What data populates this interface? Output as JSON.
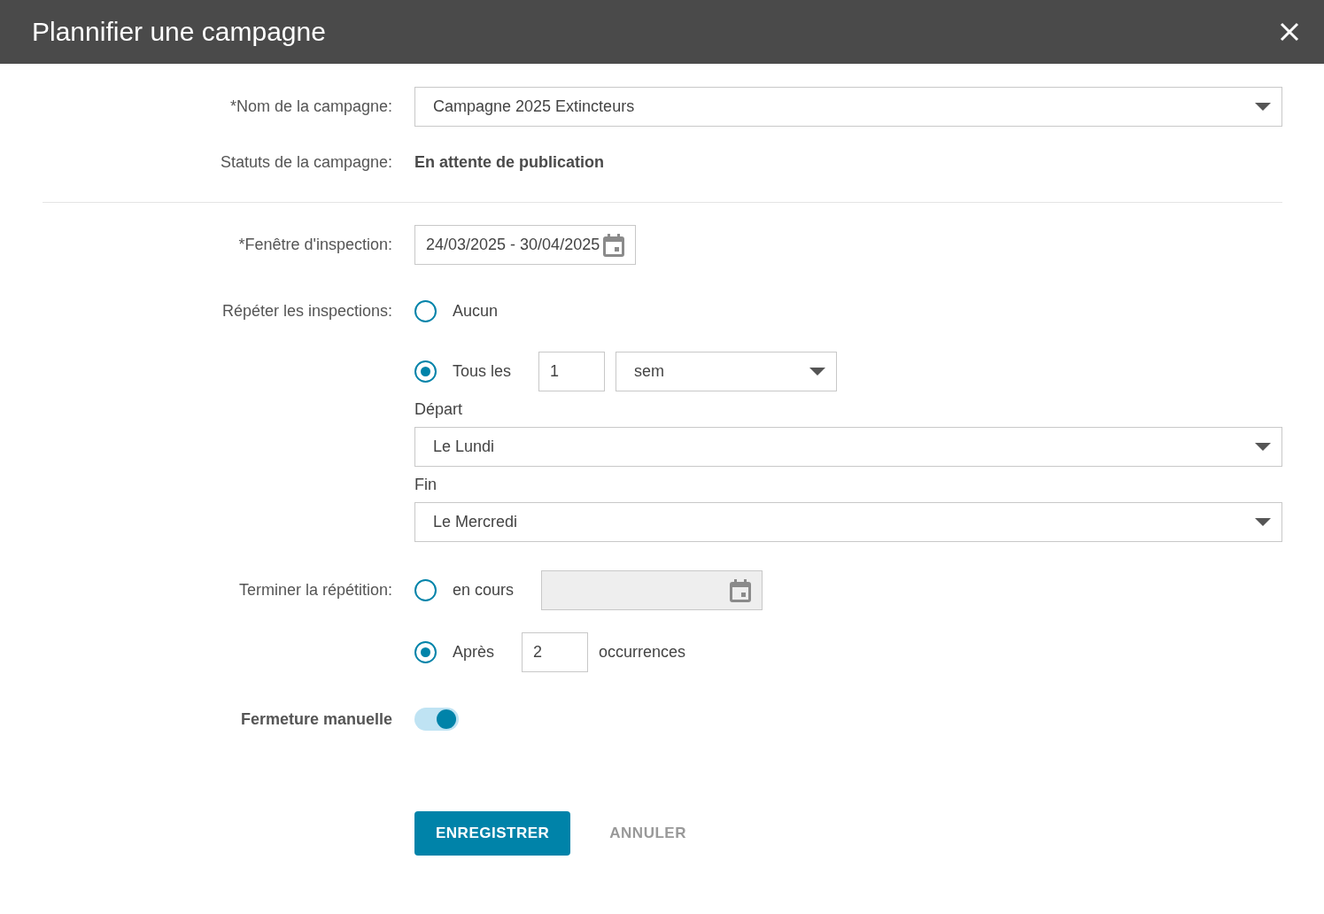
{
  "dialog": {
    "title": "Plannifier une campagne"
  },
  "campaign_name": {
    "label": "*Nom de la campagne:",
    "value": "Campagne 2025 Extincteurs"
  },
  "campaign_status": {
    "label": "Statuts de la campagne:",
    "value": "En attente de publication"
  },
  "inspection_window": {
    "label": "*Fenêtre d'inspection:",
    "value": "24/03/2025 - 30/04/2025"
  },
  "repeat": {
    "label": "Répéter les inspections:",
    "options": [
      {
        "label": "Aucun",
        "selected": false
      },
      {
        "label": "Tous les",
        "selected": true,
        "count": "1",
        "unit": "sem"
      }
    ],
    "start": {
      "label": "Départ",
      "value": "Le Lundi"
    },
    "end": {
      "label": "Fin",
      "value": "Le Mercredi"
    }
  },
  "end_repeat": {
    "label": "Terminer la répétition:",
    "options": [
      {
        "kind": "date",
        "label": "en cours",
        "selected": false,
        "disabled": true
      },
      {
        "kind": "count",
        "label": "Après",
        "selected": true,
        "value": "2",
        "suffix": "occurrences"
      }
    ]
  },
  "manual_close": {
    "label": "Fermeture manuelle",
    "on": true
  },
  "buttons": [
    {
      "label": "ENREGISTRER",
      "kind": "primary"
    },
    {
      "label": "ANNULER",
      "kind": "secondary"
    }
  ]
}
